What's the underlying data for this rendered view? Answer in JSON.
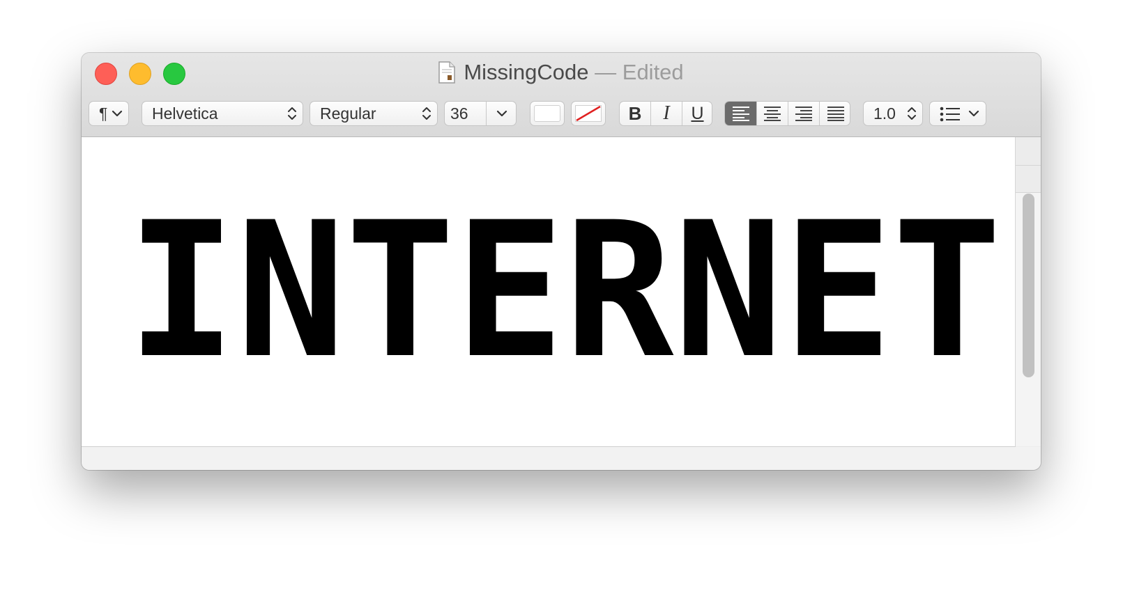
{
  "window": {
    "title": "MissingCode",
    "title_separator": "—",
    "title_status": "Edited"
  },
  "toolbar": {
    "paragraph_styles_symbol": "¶",
    "font_family": "Helvetica",
    "font_typeface": "Regular",
    "font_size": "36",
    "bold_label": "B",
    "italic_label": "I",
    "underline_label": "U",
    "line_spacing": "1.0",
    "alignment_selected": "left"
  },
  "document": {
    "text": "INTERNET"
  },
  "colors": {
    "close": "#fe5f57",
    "minimize": "#febc2e",
    "maximize": "#28c840",
    "text_color_swatch": "#ffffff",
    "active_alignment": "#6b6b6b"
  },
  "icons": [
    "document-icon",
    "chevron-down-icon",
    "updown-arrows-icon",
    "no-background-color-icon",
    "align-left-icon",
    "align-center-icon",
    "align-right-icon",
    "align-justify-icon",
    "list-bullets-icon"
  ]
}
